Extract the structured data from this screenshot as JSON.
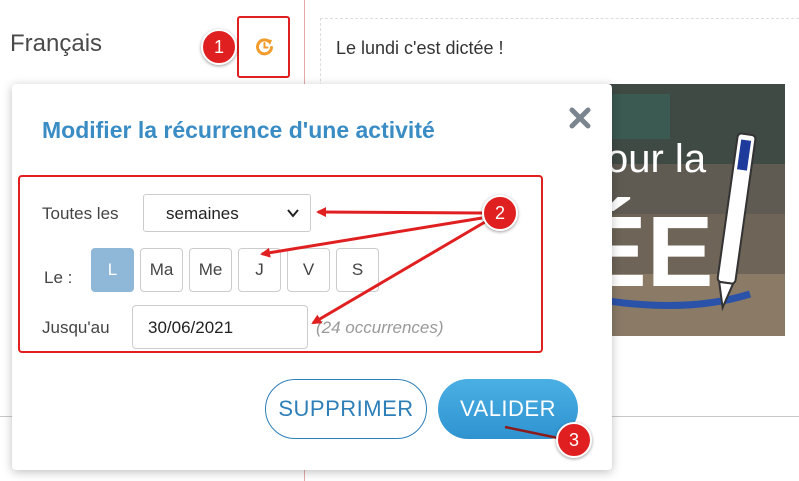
{
  "page": {
    "subject": "Français",
    "activity_title": "Le lundi c'est dictée !",
    "image_text": "our la ÉE!"
  },
  "modal": {
    "title": "Modifier la récurrence d'une activité",
    "every_label": "Toutes les",
    "frequency_value": "semaines",
    "days_label": "Le :",
    "days": [
      {
        "label": "L",
        "selected": true
      },
      {
        "label": "Ma",
        "selected": false
      },
      {
        "label": "Me",
        "selected": false
      },
      {
        "label": "J",
        "selected": false
      },
      {
        "label": "V",
        "selected": false
      },
      {
        "label": "S",
        "selected": false
      }
    ],
    "until_label": "Jusqu'au",
    "until_value": "30/06/2021",
    "occurrences": "(24 occurrences)",
    "delete_label": "SUPPRIMER",
    "validate_label": "VALIDER"
  },
  "annotations": {
    "badge1": "1",
    "badge2": "2",
    "badge3": "3"
  },
  "colors": {
    "accent_blue": "#3a8cc4",
    "annotation_red": "#e02020",
    "icon_orange": "#f39c2e",
    "selected_day": "#8fb8d8"
  }
}
